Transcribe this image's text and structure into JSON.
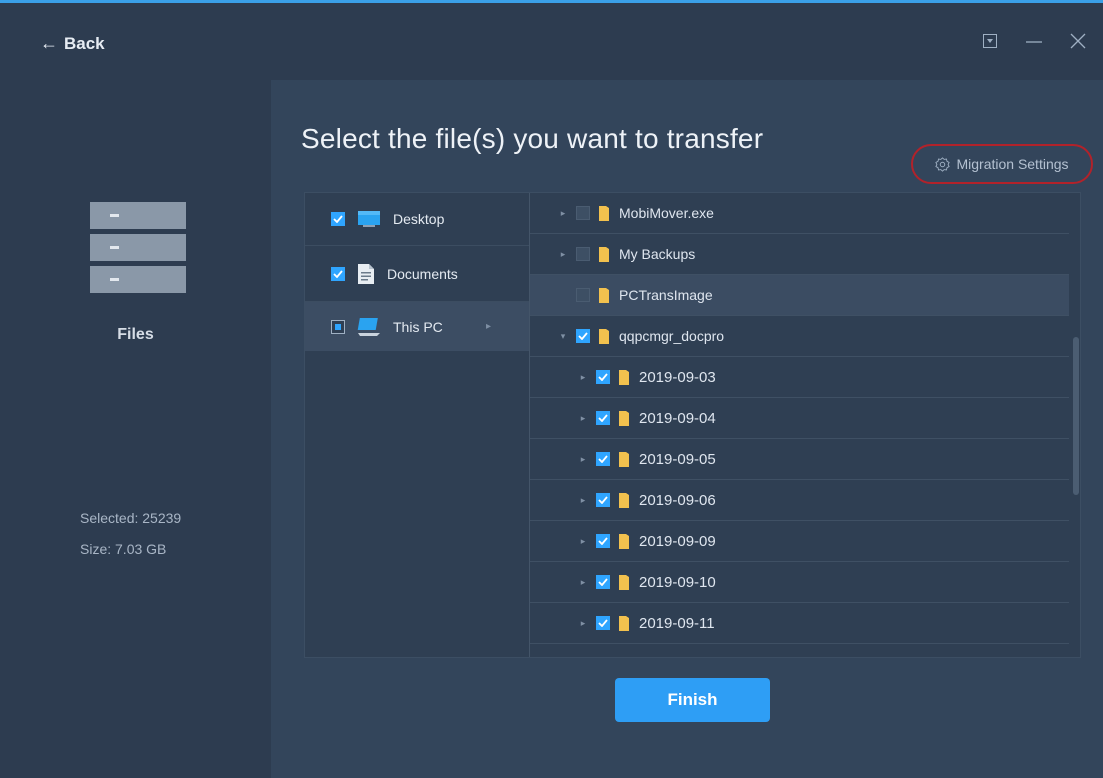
{
  "header": {
    "back_label": "Back"
  },
  "sidebar": {
    "label": "Files",
    "selected_label": "Selected:",
    "selected_count": "25239",
    "size_label": "Size:",
    "size_value": "7.03 GB"
  },
  "main": {
    "heading": "Select the file(s) you want to transfer",
    "migration_settings_label": "Migration Settings",
    "finish_label": "Finish"
  },
  "categories": [
    {
      "label": "Desktop",
      "state": "checked",
      "icon": "desktop-icon"
    },
    {
      "label": "Documents",
      "state": "checked",
      "icon": "documents-icon"
    },
    {
      "label": "This PC",
      "state": "partial",
      "icon": "this-pc-icon",
      "selected": true
    }
  ],
  "tree": [
    {
      "label": "MobiMover.exe",
      "state": "unchecked",
      "expander": "collapsed",
      "level": 0
    },
    {
      "label": "My Backups",
      "state": "unchecked",
      "expander": "collapsed",
      "level": 0
    },
    {
      "label": "PCTransImage",
      "state": "unchecked",
      "expander": "none",
      "level": 0,
      "highlighted": true
    },
    {
      "label": "qqpcmgr_docpro",
      "state": "checked",
      "expander": "expanded",
      "level": 0
    },
    {
      "label": "2019-09-03",
      "state": "checked",
      "expander": "collapsed",
      "level": 1
    },
    {
      "label": "2019-09-04",
      "state": "checked",
      "expander": "collapsed",
      "level": 1
    },
    {
      "label": "2019-09-05",
      "state": "checked",
      "expander": "collapsed",
      "level": 1
    },
    {
      "label": "2019-09-06",
      "state": "checked",
      "expander": "collapsed",
      "level": 1
    },
    {
      "label": "2019-09-09",
      "state": "checked",
      "expander": "collapsed",
      "level": 1
    },
    {
      "label": "2019-09-10",
      "state": "checked",
      "expander": "collapsed",
      "level": 1
    },
    {
      "label": "2019-09-11",
      "state": "checked",
      "expander": "collapsed",
      "level": 1
    }
  ],
  "colors": {
    "accent": "#2e9ef5",
    "checkbox_checked": "#2fa5ff",
    "highlight_outline": "#b2222a",
    "folder": "#f2c14e"
  }
}
